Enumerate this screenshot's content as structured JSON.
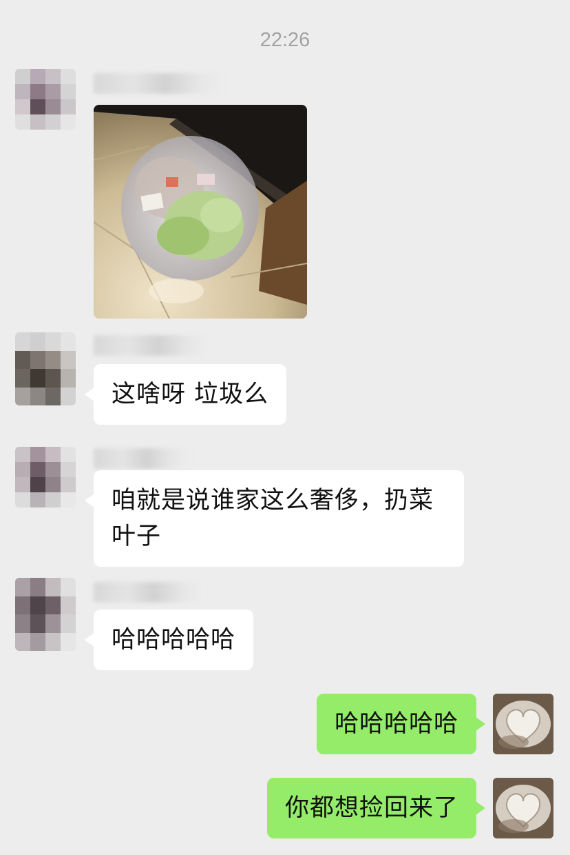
{
  "chat": {
    "timestamp": "22:26",
    "messages": [
      {
        "id": "m1",
        "side": "in",
        "type": "image",
        "image_alt": "garbage-bag-photo"
      },
      {
        "id": "m2",
        "side": "in",
        "type": "text",
        "text": "这啥呀  垃圾么"
      },
      {
        "id": "m3",
        "side": "in",
        "type": "text",
        "text": "咱就是说谁家这么奢侈，扔菜叶子"
      },
      {
        "id": "m4",
        "side": "in",
        "type": "text",
        "text": "哈哈哈哈哈"
      },
      {
        "id": "m5",
        "side": "out",
        "type": "text",
        "text": "哈哈哈哈哈"
      },
      {
        "id": "m6",
        "side": "out",
        "type": "text",
        "text": "你都想捡回来了"
      }
    ]
  },
  "colors": {
    "background": "#ededed",
    "incoming_bubble": "#ffffff",
    "outgoing_bubble": "#95ec69",
    "timestamp": "#a3a3a3"
  }
}
